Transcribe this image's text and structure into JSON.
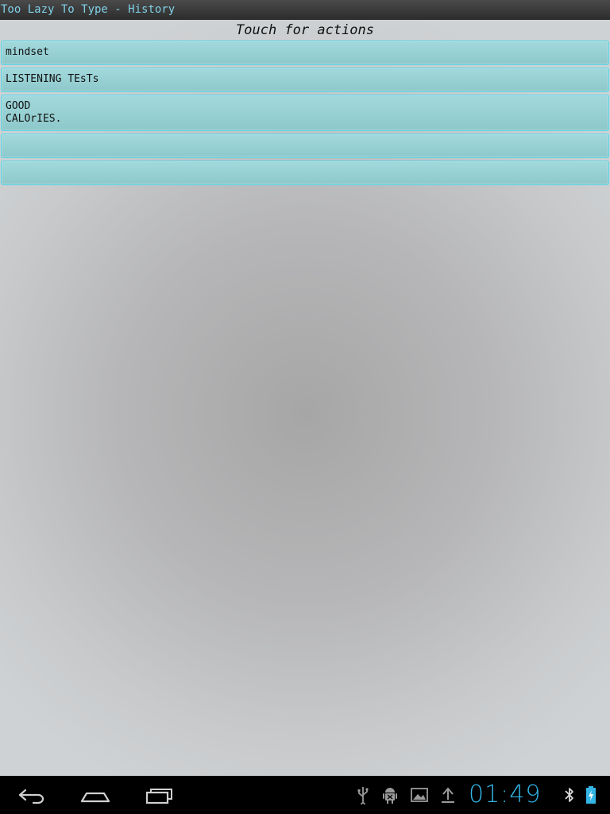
{
  "app": {
    "title": "Too Lazy To Type - History"
  },
  "header": {
    "text": "Touch for actions"
  },
  "history": {
    "items": [
      {
        "text": "mindset"
      },
      {
        "text": "LISTENING TEsTs"
      },
      {
        "text": "GOOD\nCALOrIES."
      },
      {
        "text": ""
      },
      {
        "text": ""
      }
    ]
  },
  "navbar": {
    "buttons": [
      "back-icon",
      "home-icon",
      "recent-apps-icon"
    ],
    "status_icons": [
      "usb-icon",
      "android-debug-icon",
      "gallery-icon",
      "upload-icon",
      "bluetooth-icon",
      "battery-charging-icon"
    ],
    "clock": "01:49",
    "clock_color": "#33b5e5"
  },
  "colors": {
    "title_text": "#7fd0e6",
    "row_border": "#52d3e4",
    "row_fill": "#a2d9dc"
  }
}
